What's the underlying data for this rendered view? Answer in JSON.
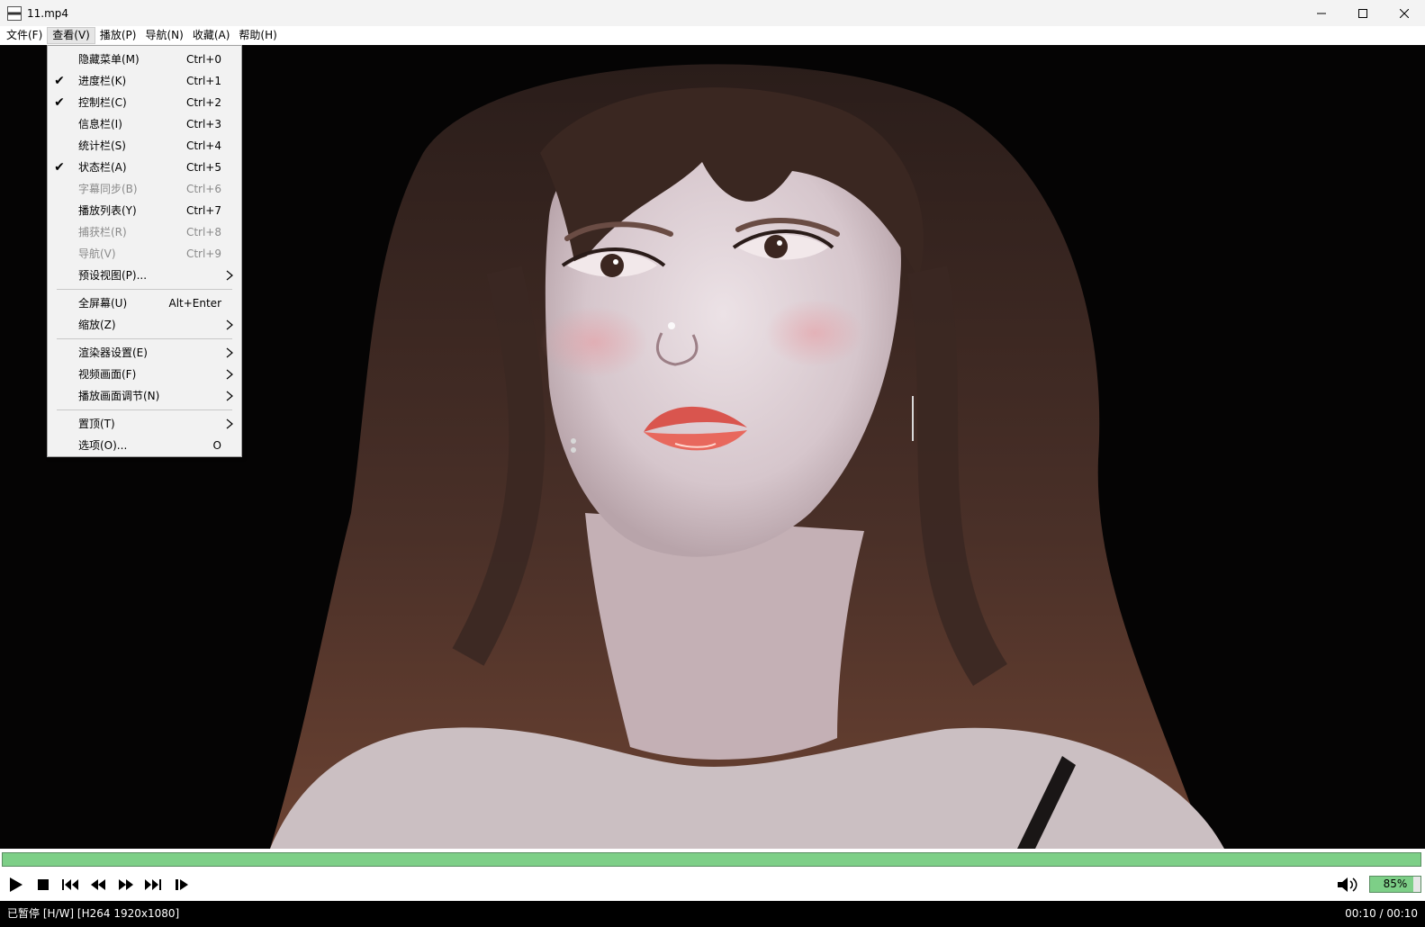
{
  "window": {
    "title": "11.mp4",
    "icon": "film-clapper-icon"
  },
  "menubar": {
    "items": [
      {
        "label": "文件(F)"
      },
      {
        "label": "查看(V)",
        "active": true
      },
      {
        "label": "播放(P)"
      },
      {
        "label": "导航(N)"
      },
      {
        "label": "收藏(A)"
      },
      {
        "label": "帮助(H)"
      }
    ]
  },
  "view_menu": {
    "items": [
      {
        "label": "隐藏菜单(M)",
        "shortcut": "Ctrl+0",
        "checked": false,
        "disabled": false
      },
      {
        "label": "进度栏(K)",
        "shortcut": "Ctrl+1",
        "checked": true,
        "disabled": false
      },
      {
        "label": "控制栏(C)",
        "shortcut": "Ctrl+2",
        "checked": true,
        "disabled": false
      },
      {
        "label": "信息栏(I)",
        "shortcut": "Ctrl+3",
        "checked": false,
        "disabled": false
      },
      {
        "label": "统计栏(S)",
        "shortcut": "Ctrl+4",
        "checked": false,
        "disabled": false
      },
      {
        "label": "状态栏(A)",
        "shortcut": "Ctrl+5",
        "checked": true,
        "disabled": false
      },
      {
        "label": "字幕同步(B)",
        "shortcut": "Ctrl+6",
        "checked": false,
        "disabled": true
      },
      {
        "label": "播放列表(Y)",
        "shortcut": "Ctrl+7",
        "checked": false,
        "disabled": false
      },
      {
        "label": "捕获栏(R)",
        "shortcut": "Ctrl+8",
        "checked": false,
        "disabled": true
      },
      {
        "label": "导航(V)",
        "shortcut": "Ctrl+9",
        "checked": false,
        "disabled": true
      },
      {
        "label": "预设视图(P)...",
        "submenu": true
      },
      {
        "separator": true
      },
      {
        "label": "全屏幕(U)",
        "shortcut": "Alt+Enter"
      },
      {
        "label": "缩放(Z)",
        "submenu": true
      },
      {
        "separator": true
      },
      {
        "label": "渲染器设置(E)",
        "submenu": true
      },
      {
        "label": "视频画面(F)",
        "submenu": true
      },
      {
        "label": "播放画面调节(N)",
        "submenu": true
      },
      {
        "separator": true
      },
      {
        "label": "置顶(T)",
        "submenu": true
      },
      {
        "label": "选项(O)...",
        "shortcut": "O"
      }
    ]
  },
  "playback": {
    "progress": 1.0,
    "volume_label": "85%",
    "volume": 0.85,
    "controls": [
      "play-icon",
      "stop-icon",
      "skip-previous-icon",
      "rewind-icon",
      "fast-forward-icon",
      "skip-next-icon",
      "frame-step-icon"
    ],
    "volume_icon": "speaker-icon"
  },
  "status": {
    "left": "已暂停 [H/W] [H264 1920x1080]",
    "right": "00:10 / 00:10"
  },
  "colors": {
    "progress_fill": "#7dcf87",
    "progress_border": "#5a8d62",
    "video_background": "#050404"
  }
}
